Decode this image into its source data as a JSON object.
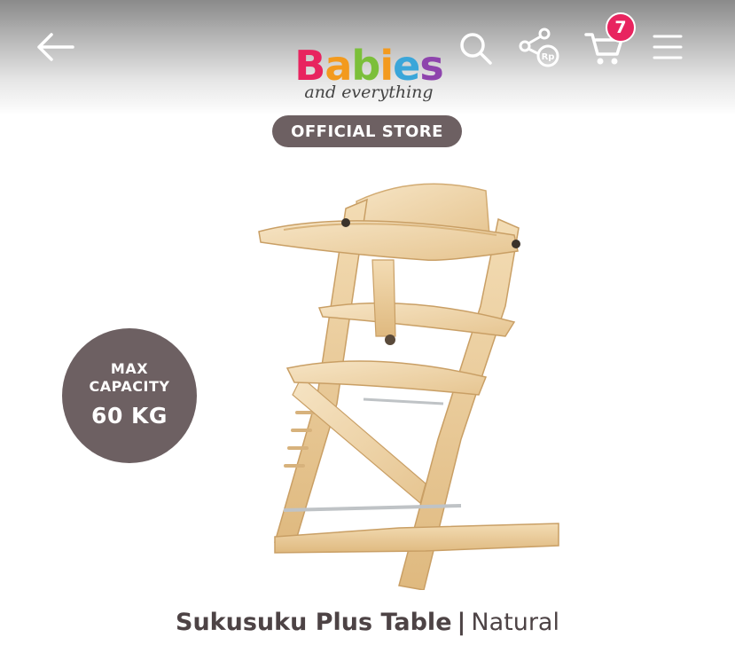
{
  "header": {
    "cart_count": "7",
    "icons": [
      "back-arrow-icon",
      "search-icon",
      "share-icon",
      "cart-icon",
      "menu-icon"
    ],
    "share_currency": "Rp"
  },
  "brand": {
    "logo_letters": [
      "B",
      "a",
      "b",
      "i",
      "e",
      "s"
    ],
    "logo_colors": [
      "#e8245f",
      "#f39a1e",
      "#7bbf3a",
      "#f39a1e",
      "#3ba6d9",
      "#8e44ad"
    ],
    "tagline": "and everything",
    "badge": "OFFICIAL STORE"
  },
  "capacity": {
    "line1": "MAX",
    "line2": "CAPACITY",
    "line3": "60 KG"
  },
  "product": {
    "name": "Sukusuku Plus Table",
    "separator": "|",
    "variant": "Natural"
  },
  "colors": {
    "badge_bg": "#6d6062",
    "cart_badge": "#e8245f",
    "wood": "#f1d9b0"
  }
}
